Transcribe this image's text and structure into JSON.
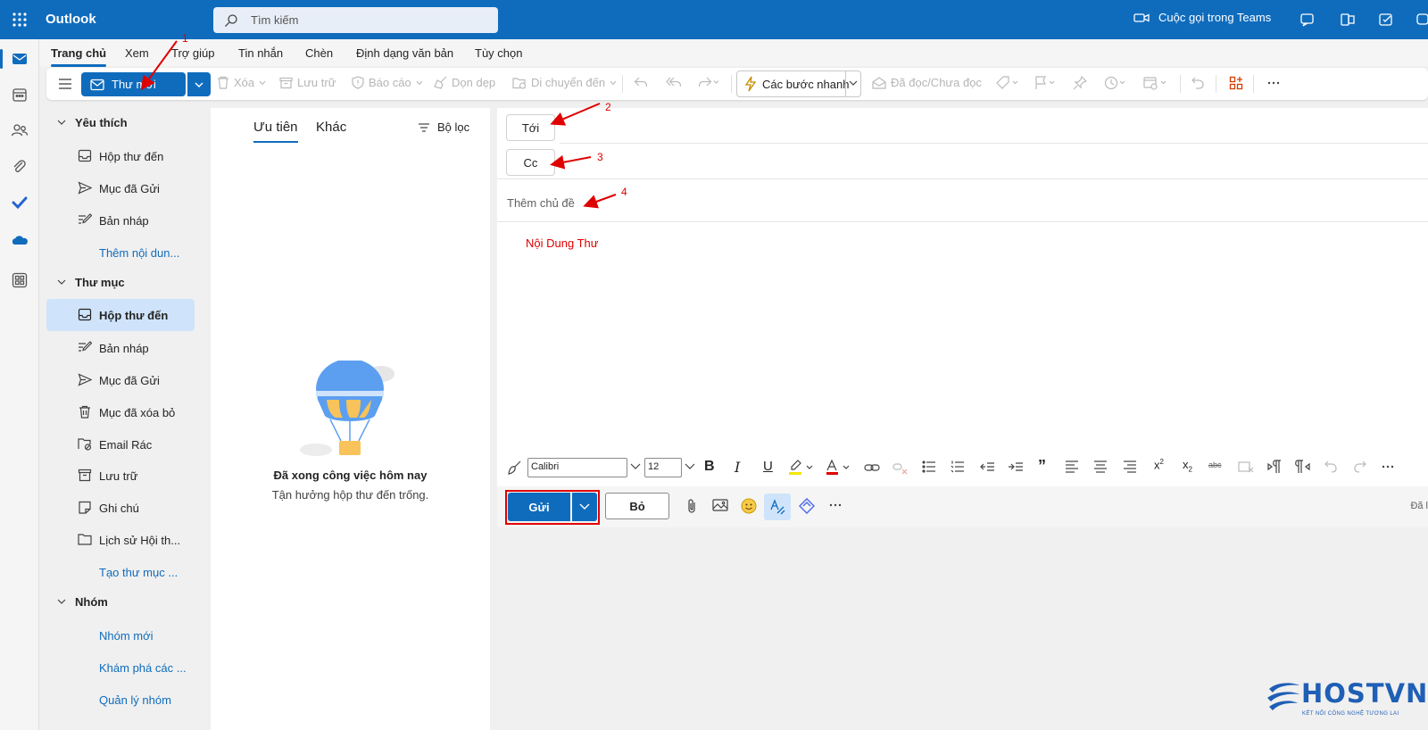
{
  "app": {
    "title": "Outlook"
  },
  "search": {
    "placeholder": "Tìm kiếm"
  },
  "topbar": {
    "teams_call": "Cuộc gọi trong Teams"
  },
  "ribbon": {
    "tabs": [
      "Trang chủ",
      "Xem",
      "Trợ giúp",
      "Tin nhắn",
      "Chèn",
      "Định dạng văn bản",
      "Tùy chọn"
    ],
    "active_tab": "Trang chủ"
  },
  "toolbar": {
    "new_mail": "Thư mới",
    "delete": "Xóa",
    "archive": "Lưu trữ",
    "report": "Báo cáo",
    "sweep": "Dọn dẹp",
    "move": "Di chuyển đến",
    "quick_steps": "Các bước nhanh",
    "read_unread": "Đã đọc/Chưa đọc"
  },
  "folders": {
    "favorites": {
      "header": "Yêu thích",
      "items": [
        "Hộp thư đến",
        "Mục đã Gửi",
        "Bản nháp"
      ],
      "add_link": "Thêm nội dun..."
    },
    "folders": {
      "header": "Thư mục",
      "items": [
        "Hộp thư đến",
        "Bản nháp",
        "Mục đã Gửi",
        "Mục đã xóa bỏ",
        "Email Rác",
        "Lưu trữ",
        "Ghi chú",
        "Lịch sử Hội th..."
      ],
      "active": "Hộp thư đến",
      "create_link": "Tạo thư mục ..."
    },
    "groups": {
      "header": "Nhóm",
      "links": [
        "Nhóm mới",
        "Khám phá các ...",
        "Quản lý nhóm"
      ]
    }
  },
  "message_list": {
    "tabs": [
      "Ưu tiên",
      "Khác"
    ],
    "active_tab": "Ưu tiên",
    "filter": "Bộ lọc",
    "empty_title": "Đã xong công việc hôm nay",
    "empty_subtitle": "Tận hưởng hộp thư đến trống."
  },
  "compose": {
    "to_label": "Tới",
    "cc_label": "Cc",
    "subject_placeholder": "Thêm chủ đề",
    "body": "Nội Dung Thư",
    "font": "Calibri",
    "size": "12",
    "send": "Gửi",
    "discard": "Bỏ",
    "draft_status": "Đã l"
  },
  "annotations": [
    "1",
    "2",
    "3",
    "4"
  ],
  "logo": {
    "text": "HOSTVN",
    "tagline": "KẾT NỐI CÔNG NGHỆ TƯƠNG LAI"
  },
  "colors": {
    "brand": "#0f6cbd",
    "annotation": "#e00000",
    "selected": "#cfe4fa"
  }
}
